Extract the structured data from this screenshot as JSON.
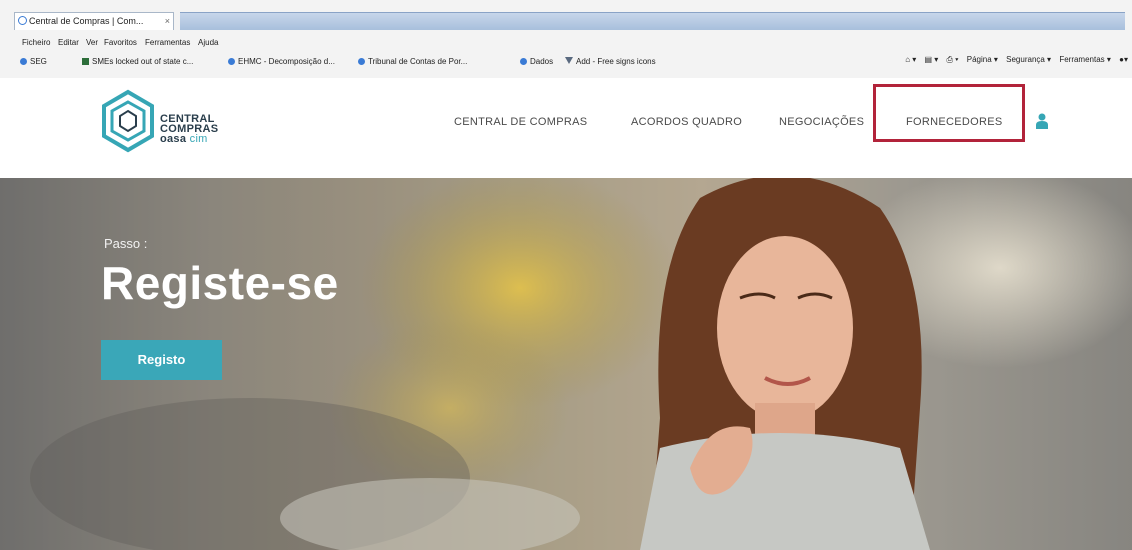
{
  "browser": {
    "tab_title": "Central de Compras | Com...",
    "tab_close": "×",
    "menu": [
      "Ficheiro",
      "Editar",
      "Ver",
      "Favoritos",
      "Ferramentas",
      "Ajuda"
    ],
    "favorites": [
      "SEG",
      "SMEs locked out of state c...",
      "EHMC - Decomposição d...",
      "Tribunal de Contas de Por...",
      "Dados",
      "Add - Free signs icons"
    ],
    "tools": [
      "Página ▾",
      "Segurança ▾",
      "Ferramentas ▾"
    ]
  },
  "site": {
    "logo": {
      "line1": "CENTRAL",
      "line2": "COMPRAS",
      "line3": "oasa",
      "line3_suffix": "cim"
    },
    "nav": [
      "CENTRAL DE COMPRAS",
      "ACORDOS QUADRO",
      "NEGOCIAÇÕES",
      "FORNECEDORES"
    ],
    "accent_color": "#36a6b5",
    "highlight_color": "#b2233a"
  },
  "hero": {
    "step_label": "Passo :",
    "title": "Registe-se",
    "button_label": "Registo"
  }
}
